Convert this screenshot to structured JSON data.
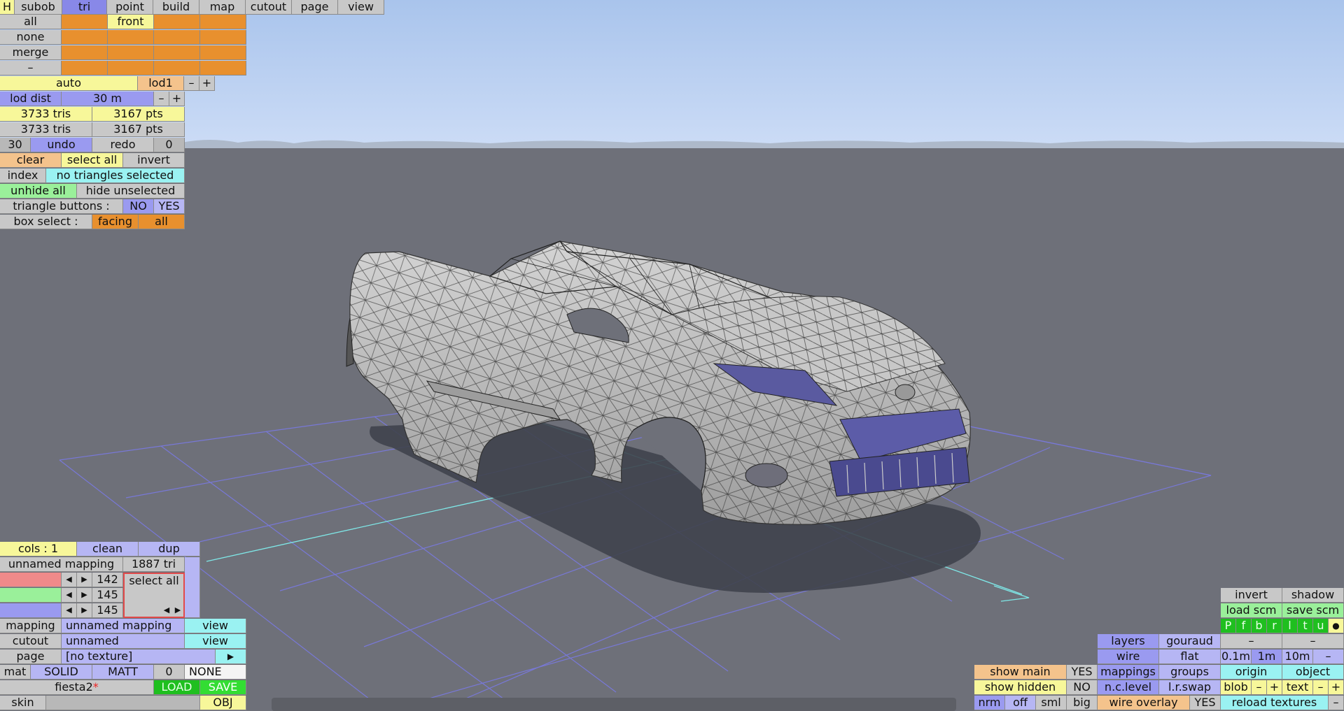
{
  "menu": {
    "h": "H",
    "tabs": [
      "subob",
      "tri",
      "point",
      "build",
      "map",
      "cutout",
      "page",
      "view"
    ],
    "active": "tri"
  },
  "select_panel": {
    "rows": [
      "all",
      "none",
      "merge",
      "–"
    ],
    "front_label": "front"
  },
  "lod": {
    "auto": "auto",
    "lod1": "lod1",
    "minus": "–",
    "plus": "+",
    "dist_label": "lod dist",
    "dist_value": "30 m"
  },
  "stats": {
    "tris1": "3733 tris",
    "pts1": "3167 pts",
    "tris2": "3733 tris",
    "pts2": "3167 pts"
  },
  "history": {
    "undo_count": "30",
    "undo": "undo",
    "redo": "redo",
    "redo_count": "0"
  },
  "selection": {
    "clear": "clear",
    "select_all": "select all",
    "invert": "invert",
    "index": "index",
    "status": "no triangles selected",
    "unhide_all": "unhide all",
    "hide_unselected": "hide unselected",
    "tri_buttons_label": "triangle buttons :",
    "no": "NO",
    "yes": "YES",
    "box_select_label": "box select :",
    "facing": "facing",
    "all": "all"
  },
  "mapping_panel": {
    "cols": "cols : 1",
    "clean": "clean",
    "dup": "dup",
    "name": "unnamed mapping",
    "tri_count": "1887 tri",
    "values": [
      "142",
      "145",
      "145"
    ],
    "select_all": "select all",
    "mapping_label": "mapping",
    "mapping_value": "unnamed mapping",
    "view": "view",
    "cutout_label": "cutout",
    "cutout_value": "unnamed",
    "page_label": "page",
    "page_value": "[no texture]",
    "mat_label": "mat",
    "solid": "SOLID",
    "matt": "MATT",
    "mat_num": "0",
    "none": "NONE",
    "file_name": "fiesta2",
    "modified_mark": "*",
    "load": "LOAD",
    "save": "SAVE",
    "skin": "skin",
    "obj": "OBJ"
  },
  "view_panel": {
    "invert": "invert",
    "shadow": "shadow",
    "load_scm": "load scm",
    "save_scm": "save scm",
    "view_letters": [
      "P",
      "f",
      "b",
      "r",
      "l",
      "t",
      "u"
    ],
    "dot": "●",
    "layers": "layers",
    "gouraud": "gouraud",
    "dash": "–",
    "wire": "wire",
    "flat": "flat",
    "m01": "0.1m",
    "m1": "1m",
    "m10": "10m",
    "show_main": "show main",
    "show_main_val": "YES",
    "mappings": "mappings",
    "groups": "groups",
    "origin": "origin",
    "object": "object",
    "show_hidden": "show hidden",
    "show_hidden_val": "NO",
    "nc_level": "n.c.level",
    "lr_swap": "l.r.swap",
    "blob": "blob",
    "text": "text",
    "minus": "–",
    "plus": "+",
    "nrm": "nrm",
    "off": "off",
    "sml": "sml",
    "big": "big",
    "wire_overlay": "wire overlay",
    "wire_overlay_val": "YES",
    "reload_textures": "reload textures"
  },
  "colors": {
    "sky_top": "#a9c4ec",
    "sky_bottom": "#ccdcf6",
    "ground": "#6e7079",
    "grid": "#7a7ae8",
    "axis": "#7fe8e8",
    "car_body": "#b9b9b9",
    "shadow": "#3f424c"
  }
}
